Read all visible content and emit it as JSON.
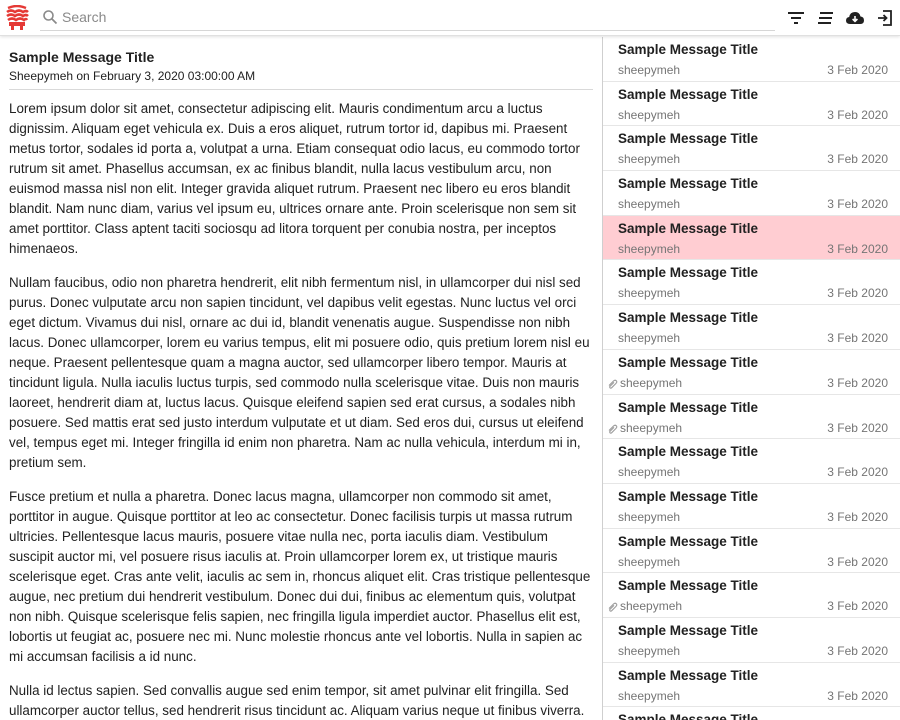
{
  "search": {
    "placeholder": "Search"
  },
  "toolbar": {
    "filter_icon": "filter-icon",
    "sort_icon": "sort-icon",
    "cloud_icon": "cloud-download-icon",
    "logout_icon": "logout-icon"
  },
  "reader": {
    "title": "Sample Message Title",
    "meta": "Sheepymeh on February 3, 2020 03:00:00 AM",
    "paragraphs": [
      "Lorem ipsum dolor sit amet, consectetur adipiscing elit. Mauris condimentum arcu a luctus dignissim. Aliquam eget vehicula ex. Duis a eros aliquet, rutrum tortor id, dapibus mi. Praesent metus tortor, sodales id porta a, volutpat a urna. Etiam consequat odio lacus, eu commodo tortor rutrum sit amet. Phasellus accumsan, ex ac finibus blandit, nulla lacus vestibulum arcu, non euismod massa nisl non elit. Integer gravida aliquet rutrum. Praesent nec libero eu eros blandit blandit. Nam nunc diam, varius vel ipsum eu, ultrices ornare ante. Proin scelerisque non sem sit amet porttitor. Class aptent taciti sociosqu ad litora torquent per conubia nostra, per inceptos himenaeos.",
      "Nullam faucibus, odio non pharetra hendrerit, elit nibh fermentum nisl, in ullamcorper dui nisl sed purus. Donec vulputate arcu non sapien tincidunt, vel dapibus velit egestas. Nunc luctus vel orci eget dictum. Vivamus dui nisl, ornare ac dui id, blandit venenatis augue. Suspendisse non nibh lacus. Donec ullamcorper, lorem eu varius tempus, elit mi posuere odio, quis pretium lorem nisl eu neque. Praesent pellentesque quam a magna auctor, sed ullamcorper libero tempor. Mauris at tincidunt ligula. Nulla iaculis luctus turpis, sed commodo nulla scelerisque vitae. Duis non mauris laoreet, hendrerit diam at, luctus lacus. Quisque eleifend sapien sed erat cursus, a sodales nibh posuere. Sed mattis erat sed justo interdum vulputate et ut diam. Sed eros dui, cursus ut eleifend vel, tempus eget mi. Integer fringilla id enim non pharetra. Nam ac nulla vehicula, interdum mi in, pretium sem.",
      "Fusce pretium et nulla a pharetra. Donec lacus magna, ullamcorper non commodo sit amet, porttitor in augue. Quisque porttitor at leo ac consectetur. Donec facilisis turpis ut massa rutrum ultricies. Pellentesque lacus mauris, posuere vitae nulla nec, porta iaculis diam. Vestibulum suscipit auctor mi, vel posuere risus iaculis at. Proin ullamcorper lorem ex, ut tristique mauris scelerisque eget. Cras ante velit, iaculis ac sem in, rhoncus aliquet elit. Cras tristique pellentesque augue, nec pretium dui hendrerit vestibulum. Donec dui dui, finibus ac elementum quis, volutpat non nibh. Quisque scelerisque felis sapien, nec fringilla ligula imperdiet auctor. Phasellus elit est, lobortis ut feugiat ac, posuere nec mi. Nunc molestie rhoncus ante vel lobortis. Nulla in sapien ac mi accumsan facilisis a id nunc.",
      "Nulla id lectus sapien. Sed convallis augue sed enim tempor, sit amet pulvinar elit fringilla. Sed ullamcorper auctor tellus, sed hendrerit risus tincidunt ac. Aliquam varius neque ut finibus viverra."
    ]
  },
  "list": {
    "items": [
      {
        "title": "Sample Message Title",
        "sender": "sheepymeh",
        "date": "3 Feb 2020",
        "attachment": false,
        "selected": false
      },
      {
        "title": "Sample Message Title",
        "sender": "sheepymeh",
        "date": "3 Feb 2020",
        "attachment": false,
        "selected": false
      },
      {
        "title": "Sample Message Title",
        "sender": "sheepymeh",
        "date": "3 Feb 2020",
        "attachment": false,
        "selected": false
      },
      {
        "title": "Sample Message Title",
        "sender": "sheepymeh",
        "date": "3 Feb 2020",
        "attachment": false,
        "selected": false
      },
      {
        "title": "Sample Message Title",
        "sender": "sheepymeh",
        "date": "3 Feb 2020",
        "attachment": false,
        "selected": true
      },
      {
        "title": "Sample Message Title",
        "sender": "sheepymeh",
        "date": "3 Feb 2020",
        "attachment": false,
        "selected": false
      },
      {
        "title": "Sample Message Title",
        "sender": "sheepymeh",
        "date": "3 Feb 2020",
        "attachment": false,
        "selected": false
      },
      {
        "title": "Sample Message Title",
        "sender": "sheepymeh",
        "date": "3 Feb 2020",
        "attachment": true,
        "selected": false
      },
      {
        "title": "Sample Message Title",
        "sender": "sheepymeh",
        "date": "3 Feb 2020",
        "attachment": true,
        "selected": false
      },
      {
        "title": "Sample Message Title",
        "sender": "sheepymeh",
        "date": "3 Feb 2020",
        "attachment": false,
        "selected": false
      },
      {
        "title": "Sample Message Title",
        "sender": "sheepymeh",
        "date": "3 Feb 2020",
        "attachment": false,
        "selected": false
      },
      {
        "title": "Sample Message Title",
        "sender": "sheepymeh",
        "date": "3 Feb 2020",
        "attachment": false,
        "selected": false
      },
      {
        "title": "Sample Message Title",
        "sender": "sheepymeh",
        "date": "3 Feb 2020",
        "attachment": true,
        "selected": false
      },
      {
        "title": "Sample Message Title",
        "sender": "sheepymeh",
        "date": "3 Feb 2020",
        "attachment": false,
        "selected": false
      },
      {
        "title": "Sample Message Title",
        "sender": "sheepymeh",
        "date": "3 Feb 2020",
        "attachment": false,
        "selected": false
      },
      {
        "title": "Sample Message Title",
        "sender": "",
        "date": "",
        "attachment": false,
        "selected": false
      }
    ]
  },
  "colors": {
    "accent": "#e53935",
    "selected_row": "#ffcdd2",
    "muted_text": "#757575"
  }
}
